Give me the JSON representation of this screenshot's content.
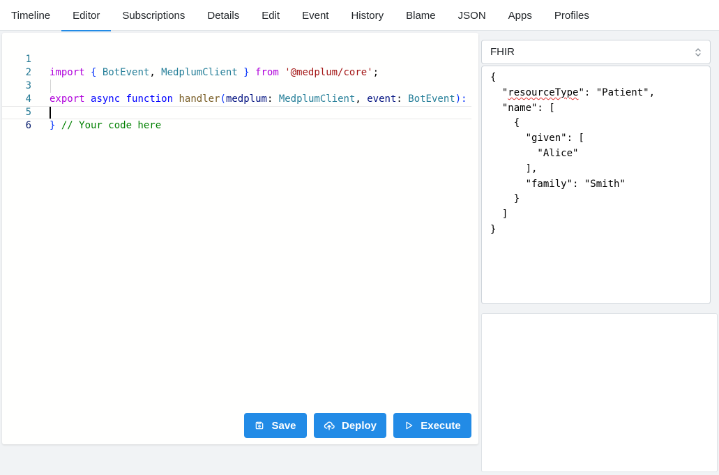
{
  "tabs": [
    {
      "label": "Timeline"
    },
    {
      "label": "Editor"
    },
    {
      "label": "Subscriptions"
    },
    {
      "label": "Details"
    },
    {
      "label": "Edit"
    },
    {
      "label": "Event"
    },
    {
      "label": "History"
    },
    {
      "label": "Blame"
    },
    {
      "label": "JSON"
    },
    {
      "label": "Apps"
    },
    {
      "label": "Profiles"
    }
  ],
  "active_tab": "Editor",
  "editor": {
    "line_numbers": [
      "1",
      "2",
      "3",
      "4",
      "5",
      "6"
    ],
    "code": {
      "line1": {
        "import": "import",
        "open_brace": " { ",
        "bot_event": "BotEvent",
        "comma": ", ",
        "medplum_client": "MedplumClient",
        "close_brace": " } ",
        "from": "from",
        "module": "'@medplum/core'",
        "semi": ";"
      },
      "line3": {
        "export": "export",
        "async": "async",
        "function": "function",
        "handler": "handler",
        "open_paren": "(",
        "param1": "medplum",
        "colon1": ": ",
        "type1": "MedplumClient",
        "comma": ", ",
        "param2": "event",
        "colon2": ": ",
        "type2": "BotEvent",
        "close": "):"
      },
      "line4": {
        "comment": "// Your code here"
      },
      "line5": {
        "close_brace": "}"
      }
    },
    "buttons": {
      "save": "Save",
      "deploy": "Deploy",
      "execute": "Execute"
    }
  },
  "side": {
    "select_value": "FHIR",
    "json_lines": [
      {
        "pre": "{",
        "key": "",
        "post": ""
      },
      {
        "pre": "  \"",
        "key": "resourceType",
        "post": "\": \"Patient\","
      },
      {
        "pre": "  \"name\": [",
        "key": "",
        "post": ""
      },
      {
        "pre": "    {",
        "key": "",
        "post": ""
      },
      {
        "pre": "      \"given\": [",
        "key": "",
        "post": ""
      },
      {
        "pre": "        \"Alice\"",
        "key": "",
        "post": ""
      },
      {
        "pre": "      ],",
        "key": "",
        "post": ""
      },
      {
        "pre": "      \"family\": \"Smith\"",
        "key": "",
        "post": ""
      },
      {
        "pre": "    }",
        "key": "",
        "post": ""
      },
      {
        "pre": "  ]",
        "key": "",
        "post": ""
      },
      {
        "pre": "}",
        "key": "",
        "post": ""
      }
    ]
  },
  "colors": {
    "accent": "#228be6",
    "keyword": "#0000ff",
    "string": "#a31515",
    "comment": "#008000",
    "line_number": "#237893",
    "spellcheck": "#e03131"
  },
  "icons": {
    "save": "device-floppy-icon",
    "deploy": "cloud-upload-icon",
    "execute": "player-play-icon",
    "select": "selector-chevrons-icon"
  }
}
